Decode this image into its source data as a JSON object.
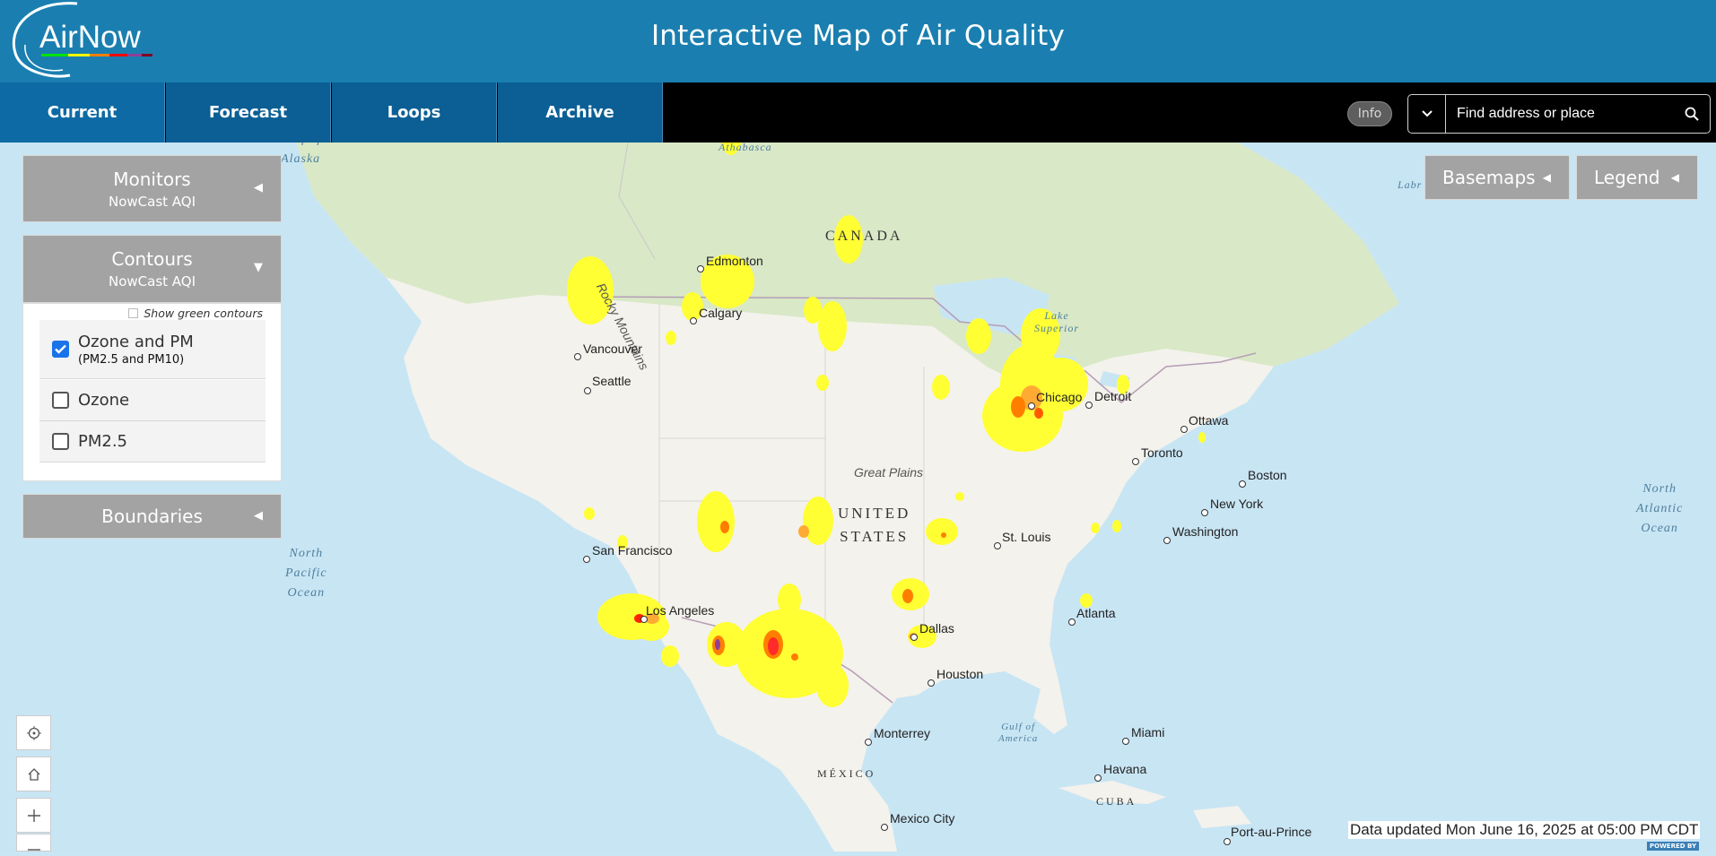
{
  "header": {
    "logo_text": "AirNow",
    "title": "Interactive Map of Air Quality"
  },
  "nav": {
    "tabs": [
      {
        "label": "Current"
      },
      {
        "label": "Forecast"
      },
      {
        "label": "Loops"
      },
      {
        "label": "Archive"
      }
    ],
    "info_label": "Info",
    "search_placeholder": "Find address or place"
  },
  "panels": {
    "monitors": {
      "title": "Monitors",
      "subtitle": "NowCast AQI"
    },
    "contours": {
      "title": "Contours",
      "subtitle": "NowCast AQI",
      "show_green_label": "Show green contours",
      "options": [
        {
          "label": "Ozone and PM",
          "sub": "(PM2.5 and PM10)",
          "checked": true
        },
        {
          "label": "Ozone",
          "sub": "",
          "checked": false
        },
        {
          "label": "PM2.5",
          "sub": "",
          "checked": false
        }
      ]
    },
    "boundaries": {
      "title": "Boundaries"
    }
  },
  "map_buttons": {
    "basemaps": "Basemaps",
    "legend": "Legend"
  },
  "map": {
    "cities": [
      "Edmonton",
      "Calgary",
      "Vancouver",
      "Seattle",
      "San Francisco",
      "Los Angeles",
      "Dallas",
      "Houston",
      "Monterrey",
      "Mexico City",
      "St. Louis",
      "Chicago",
      "Detroit",
      "Toronto",
      "Ottawa",
      "Boston",
      "New York",
      "Washington",
      "Atlanta",
      "Miami",
      "Havana",
      "Port-au-Prince"
    ],
    "regions": {
      "canada": "CANADA",
      "us_line1": "UNITED",
      "us_line2": "STATES",
      "mexico": "MÉXICO",
      "cuba": "CUBA",
      "great_plains": "Great Plains",
      "rocky_mountains": "Rocky Mountains",
      "athabasca": "Athabasca",
      "lake_superior_1": "Lake",
      "lake_superior_2": "Superior",
      "gulf_alaska_1": "Gulf of",
      "gulf_alaska_2": "Alaska",
      "north_pacific_1": "North",
      "north_pacific_2": "Pacific",
      "north_pacific_3": "Ocean",
      "north_atlantic_1": "North",
      "north_atlantic_2": "Atlantic",
      "north_atlantic_3": "Ocean",
      "gulf_mexico_1": "Gulf of",
      "gulf_mexico_2": "America",
      "labrador": "Labr"
    },
    "aqi_colors": {
      "moderate": "#ffff00",
      "usg": "#ff7e00",
      "unhealthy": "#ff0000",
      "very_unhealthy": "#8f3f97"
    }
  },
  "footer": {
    "updated": "Data updated Mon June 16, 2025 at 05:00 PM CDT",
    "powered": "POWERED BY"
  }
}
